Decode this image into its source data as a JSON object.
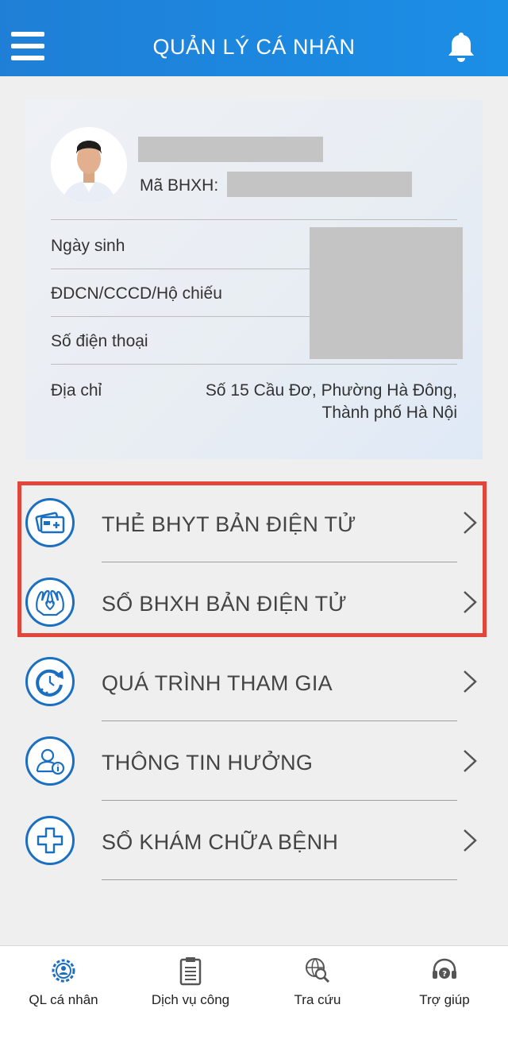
{
  "header": {
    "title": "QUẢN LÝ CÁ NHÂN",
    "menu_icon": "hamburger-icon",
    "notification_icon": "bell-icon"
  },
  "profile": {
    "bhxh_label": "Mã BHXH:",
    "fields": [
      {
        "label": "Ngày sinh"
      },
      {
        "label": "ĐDCN/CCCD/Hộ chiếu"
      },
      {
        "label": "Số điện thoại"
      },
      {
        "label": "Địa chỉ"
      }
    ],
    "address_line1": "Số 15 Cầu Đơ, Phường Hà Đông,",
    "address_line2": "Thành phố Hà Nội"
  },
  "menu": [
    {
      "label": "THẺ BHYT BẢN ĐIỆN TỬ",
      "icon": "card-icon"
    },
    {
      "label": "SỔ BHXH BẢN ĐIỆN TỬ",
      "icon": "hands-heart-icon"
    },
    {
      "label": "QUÁ TRÌNH THAM GIA",
      "icon": "history-icon"
    },
    {
      "label": "THÔNG TIN HƯỞNG",
      "icon": "user-info-icon"
    },
    {
      "label": "SỔ KHÁM CHỮA BỆNH",
      "icon": "medical-cross-icon"
    }
  ],
  "highlight_color": "#e0463a",
  "accent_color": "#1b6fc0",
  "bottom_nav": [
    {
      "label": "QL cá nhân",
      "icon": "personal-gear-icon"
    },
    {
      "label": "Dịch vụ công",
      "icon": "clipboard-icon"
    },
    {
      "label": "Tra cứu",
      "icon": "globe-search-icon"
    },
    {
      "label": "Trợ giúp",
      "icon": "headset-help-icon"
    }
  ]
}
